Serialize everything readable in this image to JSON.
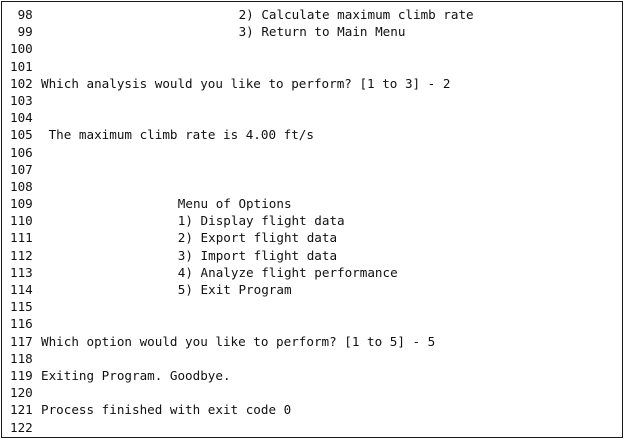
{
  "console": {
    "lines": [
      {
        "num": " 98",
        "text": "2) Calculate maximum climb rate",
        "col": 26
      },
      {
        "num": " 99",
        "text": "3) Return to Main Menu",
        "col": 26
      },
      {
        "num": "100",
        "text": "",
        "col": 0
      },
      {
        "num": "101",
        "text": "",
        "col": 0
      },
      {
        "num": "102",
        "text": "Which analysis would you like to perform? [1 to 3] - 2",
        "col": 0
      },
      {
        "num": "103",
        "text": "",
        "col": 0
      },
      {
        "num": "104",
        "text": "",
        "col": 0
      },
      {
        "num": "105",
        "text": "The maximum climb rate is 4.00 ft/s",
        "col": 1
      },
      {
        "num": "106",
        "text": "",
        "col": 0
      },
      {
        "num": "107",
        "text": "",
        "col": 0
      },
      {
        "num": "108",
        "text": "",
        "col": 0
      },
      {
        "num": "109",
        "text": "Menu of Options",
        "col": 18
      },
      {
        "num": "110",
        "text": "1) Display flight data",
        "col": 18
      },
      {
        "num": "111",
        "text": "2) Export flight data",
        "col": 18
      },
      {
        "num": "112",
        "text": "3) Import flight data",
        "col": 18
      },
      {
        "num": "113",
        "text": "4) Analyze flight performance",
        "col": 18
      },
      {
        "num": "114",
        "text": "5) Exit Program",
        "col": 18
      },
      {
        "num": "115",
        "text": "",
        "col": 0
      },
      {
        "num": "116",
        "text": "",
        "col": 0
      },
      {
        "num": "117",
        "text": "Which option would you like to perform? [1 to 5] - 5",
        "col": 0
      },
      {
        "num": "118",
        "text": "",
        "col": 0
      },
      {
        "num": "119",
        "text": "Exiting Program. Goodbye.",
        "col": 0
      },
      {
        "num": "120",
        "text": "",
        "col": 0
      },
      {
        "num": "121",
        "text": "Process finished with exit code 0",
        "col": 0
      },
      {
        "num": "122",
        "text": "",
        "col": 0
      }
    ]
  }
}
